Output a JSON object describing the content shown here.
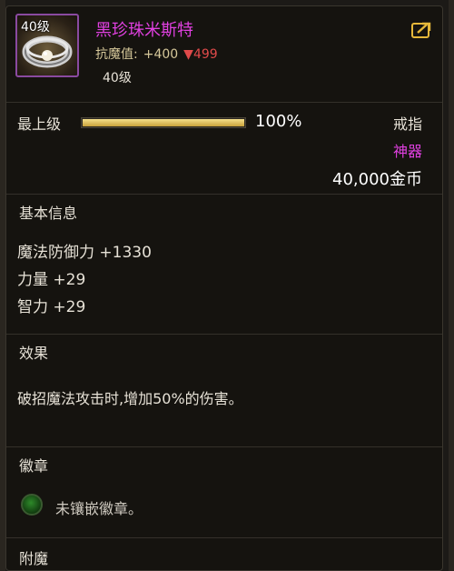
{
  "item": {
    "level_badge": "40级",
    "name": "黑珍珠米斯特",
    "resist_label": "抗魔值:",
    "resist_up": "+400",
    "resist_down": "▼499",
    "required_level": "40级",
    "share_icon": "share-icon"
  },
  "quality": {
    "label": "最上级",
    "percent": 100,
    "percent_text": "100%"
  },
  "meta": {
    "slot": "戒指",
    "grade": "神器",
    "price": "40,000金币"
  },
  "basic_info": {
    "title": "基本信息",
    "stats": [
      "魔法防御力 +1330",
      "力量 +29",
      "智力 +29"
    ]
  },
  "effect": {
    "title": "效果",
    "text": "破招魔法攻击时,增加50%的伤害。"
  },
  "emblem": {
    "title": "徽章",
    "text": "未镶嵌徽章。"
  },
  "appendix": {
    "title": "附魔"
  },
  "colors": {
    "name": "#e040e0",
    "grade": "#e040e0",
    "resist_down": "#e04a4a",
    "bar_fill": "#c9a13a"
  }
}
